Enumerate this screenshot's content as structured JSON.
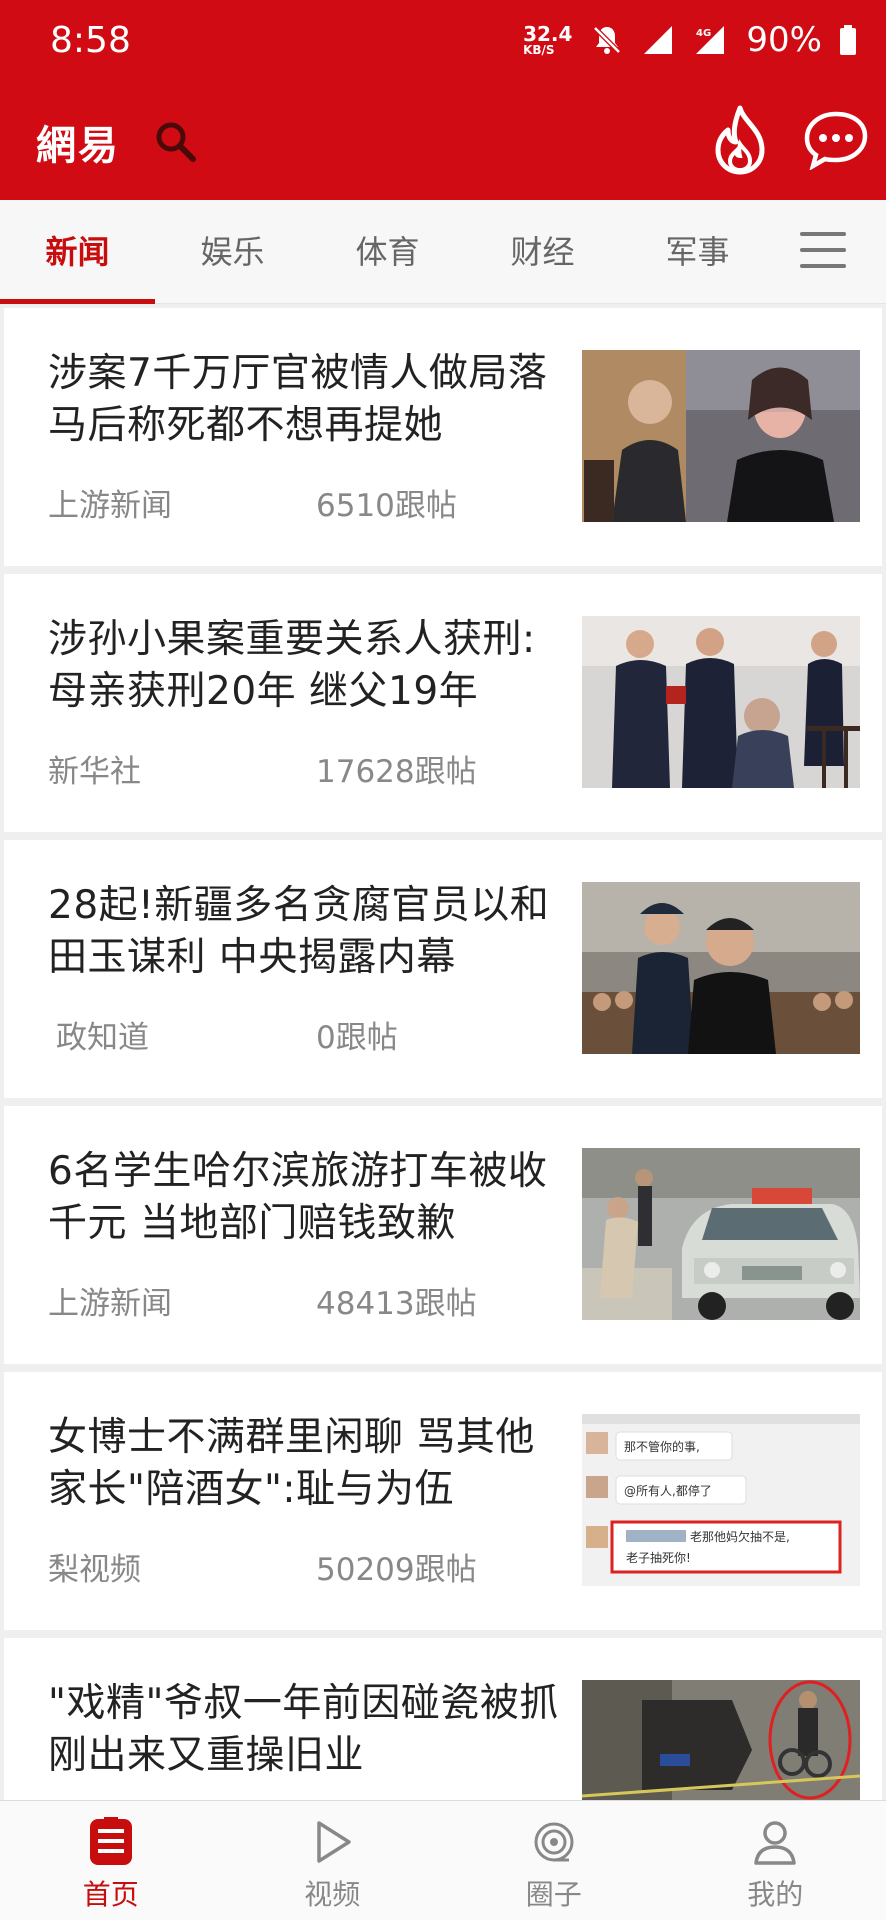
{
  "status_bar": {
    "time": "8:58",
    "net_speed_value": "32.4",
    "net_speed_unit": "KB/S",
    "network_label": "4G",
    "battery": "90%"
  },
  "header": {
    "logo": "網易",
    "search_icon": "search-icon",
    "hot_icon": "flame-icon",
    "message_icon": "chat-bubble-icon"
  },
  "tabs": [
    {
      "label": "新闻",
      "active": true
    },
    {
      "label": "娱乐",
      "active": false
    },
    {
      "label": "体育",
      "active": false
    },
    {
      "label": "财经",
      "active": false
    },
    {
      "label": "军事",
      "active": false
    }
  ],
  "feed": [
    {
      "title": "涉案7千万厅官被情人做局落马后称死都不想再提她",
      "source": "上游新闻",
      "comments": "6510跟帖"
    },
    {
      "title": "涉孙小果案重要关系人获刑:母亲获刑20年 继父19年",
      "source": "新华社",
      "comments": "17628跟帖"
    },
    {
      "title": "28起!新疆多名贪腐官员以和田玉谋利 中央揭露内幕",
      "source": "政知道",
      "comments": "0跟帖"
    },
    {
      "title": "6名学生哈尔滨旅游打车被收千元 当地部门赔钱致歉",
      "source": "上游新闻",
      "comments": "48413跟帖"
    },
    {
      "title": "女博士不满群里闲聊 骂其他家长\"陪酒女\":耻与为伍",
      "source": "梨视频",
      "comments": "50209跟帖"
    },
    {
      "title": "\"戏精\"爷叔一年前因碰瓷被抓 刚出来又重操旧业",
      "source": "",
      "comments": ""
    }
  ],
  "chat_screenshot": {
    "line1": "那不管你的事,",
    "line2": "@所有人,都停了",
    "line3": "老那他妈欠抽不是,",
    "line4": "老子抽死你!"
  },
  "bottom_nav": [
    {
      "label": "首页",
      "active": true
    },
    {
      "label": "视频",
      "active": false
    },
    {
      "label": "圈子",
      "active": false
    },
    {
      "label": "我的",
      "active": false
    }
  ],
  "colors": {
    "brand_red": "#d10b13",
    "active_red": "#c70d0d"
  }
}
